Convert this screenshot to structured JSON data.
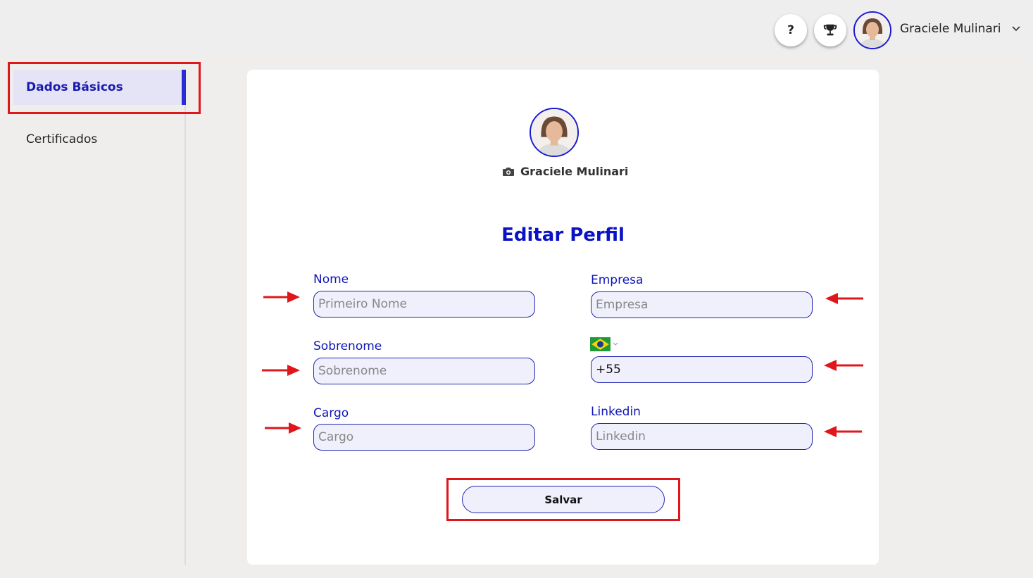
{
  "header": {
    "help_label": "?",
    "user_name": "Graciele Mulinari"
  },
  "sidebar": {
    "items": [
      {
        "label": "Dados Básicos",
        "active": true
      },
      {
        "label": "Certificados",
        "active": false
      }
    ]
  },
  "profile": {
    "name": "Graciele Mulinari"
  },
  "form": {
    "title": "Editar Perfil",
    "fields": {
      "nome": {
        "label": "Nome",
        "placeholder": "Primeiro Nome",
        "value": ""
      },
      "sobrenome": {
        "label": "Sobrenome",
        "placeholder": "Sobrenome",
        "value": ""
      },
      "cargo": {
        "label": "Cargo",
        "placeholder": "Cargo",
        "value": ""
      },
      "empresa": {
        "label": "Empresa",
        "placeholder": "Empresa",
        "value": ""
      },
      "telefone": {
        "placeholder": "",
        "value": "+55"
      },
      "linkedin": {
        "label": "Linkedin",
        "placeholder": "Linkedin",
        "value": ""
      }
    },
    "save_label": "Salvar"
  },
  "colors": {
    "accent": "#0a12c4",
    "highlight": "#e0161b",
    "input_bg": "#eff0fc"
  },
  "icons": [
    "help-icon",
    "trophy-icon",
    "chevron-down-icon",
    "camera-icon",
    "brazil-flag-icon"
  ]
}
